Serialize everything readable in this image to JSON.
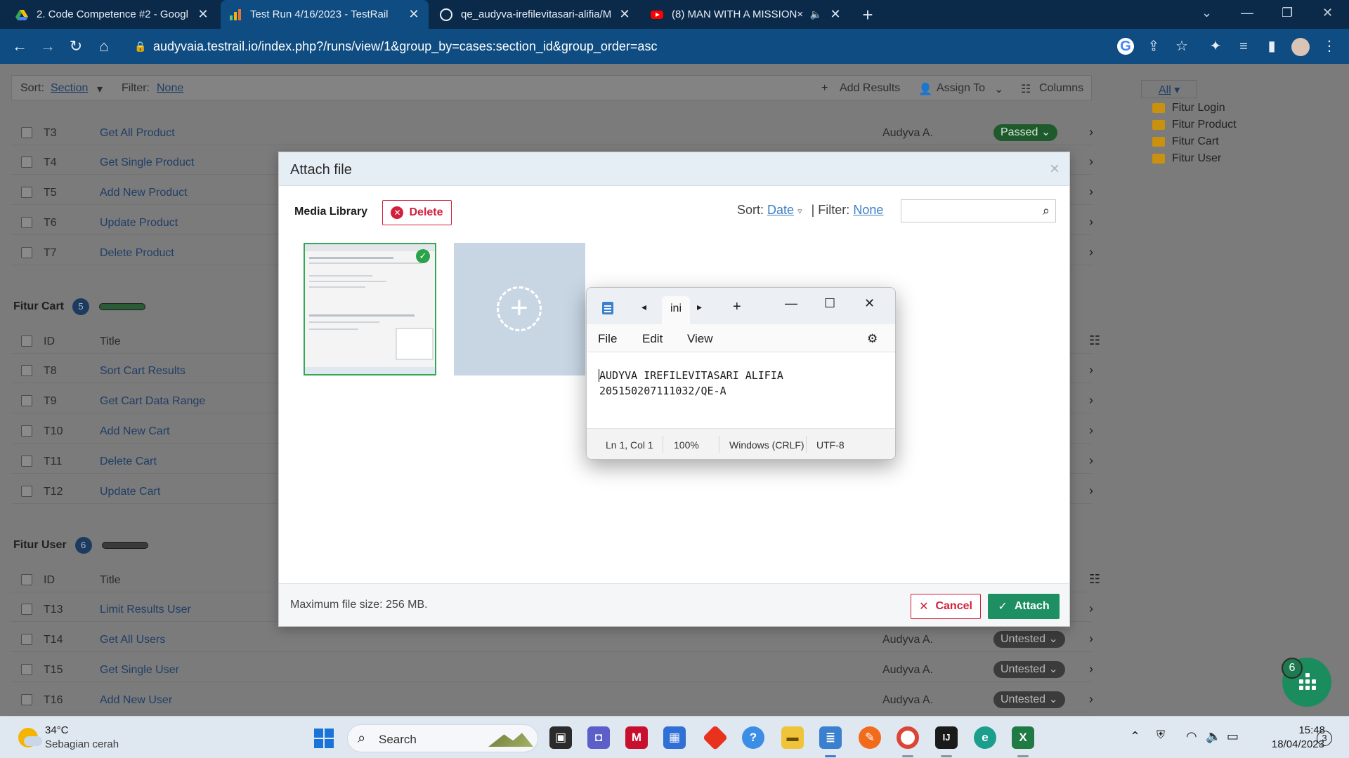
{
  "browser": {
    "tabs": [
      {
        "title": "2. Code Competence #2 - Googl",
        "icon": "google-drive-icon",
        "active": false
      },
      {
        "title": "Test Run 4/16/2023 - TestRail",
        "icon": "testrail-icon",
        "active": true
      },
      {
        "title": "qe_audyva-irefilevitasari-alifia/M",
        "icon": "github-icon",
        "active": false
      },
      {
        "title": "(8) MAN WITH A MISSION×",
        "icon": "youtube-icon",
        "active": false
      }
    ],
    "url": "audyvaia.testrail.io/index.php?/runs/view/1&group_by=cases:section_id&group_order=asc"
  },
  "toolbar": {
    "sort_label": "Sort:",
    "sort_value": "Section",
    "filter_label": "Filter:",
    "filter_value": "None",
    "add_results": "Add Results",
    "assign_to": "Assign To",
    "columns": "Columns"
  },
  "sidebar": {
    "filter_all": "All",
    "sections": [
      "Fitur Login",
      "Fitur Product",
      "Fitur Cart",
      "Fitur User"
    ]
  },
  "product_rows": [
    {
      "id": "T3",
      "title": "Get All Product",
      "assignee": "Audyva A.",
      "status": "Passed"
    },
    {
      "id": "T4",
      "title": "Get Single Product"
    },
    {
      "id": "T5",
      "title": "Add New Product"
    },
    {
      "id": "T6",
      "title": "Update Product"
    },
    {
      "id": "T7",
      "title": "Delete Product"
    }
  ],
  "cart_section": {
    "name": "Fitur Cart",
    "count": "5"
  },
  "cart_header": {
    "id": "ID",
    "title": "Title"
  },
  "cart_rows": [
    {
      "id": "T8",
      "title": "Sort Cart Results"
    },
    {
      "id": "T9",
      "title": "Get Cart Data Range"
    },
    {
      "id": "T10",
      "title": "Add New Cart"
    },
    {
      "id": "T11",
      "title": "Delete Cart"
    },
    {
      "id": "T12",
      "title": "Update Cart"
    }
  ],
  "user_section": {
    "name": "Fitur User",
    "count": "6"
  },
  "user_header": {
    "id": "ID",
    "title": "Title"
  },
  "user_rows": [
    {
      "id": "T13",
      "title": "Limit Results User"
    },
    {
      "id": "T14",
      "title": "Get All Users",
      "assignee": "Audyva A.",
      "status": "Untested"
    },
    {
      "id": "T15",
      "title": "Get Single User",
      "assignee": "Audyva A.",
      "status": "Untested"
    },
    {
      "id": "T16",
      "title": "Add New User",
      "assignee": "Audyva A.",
      "status": "Untested"
    }
  ],
  "modal": {
    "title": "Attach file",
    "media_library": "Media Library",
    "delete": "Delete",
    "sort_label": "Sort:",
    "sort_value": "Date",
    "filter_label": "| Filter:",
    "filter_value": "None",
    "max_size": "Maximum file size: 256 MB.",
    "cancel": "Cancel",
    "attach": "Attach"
  },
  "notepad": {
    "tab_title": "ini",
    "menu": [
      "File",
      "Edit",
      "View"
    ],
    "lines": [
      "AUDYVA IREFILEVITASARI ALIFIA",
      "205150207111032/QE-A"
    ],
    "status": {
      "position": "Ln 1, Col 1",
      "zoom": "100%",
      "line_ending": "Windows (CRLF)",
      "encoding": "UTF-8"
    }
  },
  "help_badge": "6",
  "taskbar": {
    "weather_temp": "34°C",
    "weather_desc": "Sebagian cerah",
    "search": "Search",
    "time": "15:48",
    "date": "18/04/2023",
    "notifications": "3"
  },
  "colors": {
    "chrome": "#0f4c81",
    "accent_green": "#1e8e63",
    "danger": "#d21f3c",
    "link": "#3b7fc4"
  }
}
